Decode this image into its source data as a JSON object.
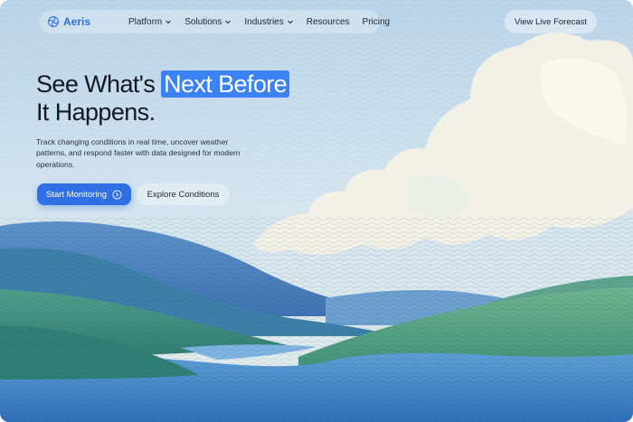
{
  "brand": {
    "name": "Aeris",
    "logo_icon": "aeris-swirl-icon",
    "accent": "#2f6fde"
  },
  "nav": {
    "items": [
      {
        "label": "Platform",
        "has_dropdown": true
      },
      {
        "label": "Solutions",
        "has_dropdown": true
      },
      {
        "label": "Industries",
        "has_dropdown": true
      },
      {
        "label": "Resources",
        "has_dropdown": false
      },
      {
        "label": "Pricing",
        "has_dropdown": false
      }
    ],
    "cta_label": "View Live Forecast"
  },
  "hero": {
    "headline_before": "See What's ",
    "headline_highlight": "Next Before",
    "headline_after": "It Happens.",
    "subtext": "Track changing conditions in real time, uncover weather patterns, and respond faster with data designed for modern operations.",
    "primary_cta": "Start Monitoring",
    "primary_cta_icon": "chevron-right-circle-icon",
    "secondary_cta": "Explore Conditions",
    "highlight_color": "#3b82f6"
  }
}
